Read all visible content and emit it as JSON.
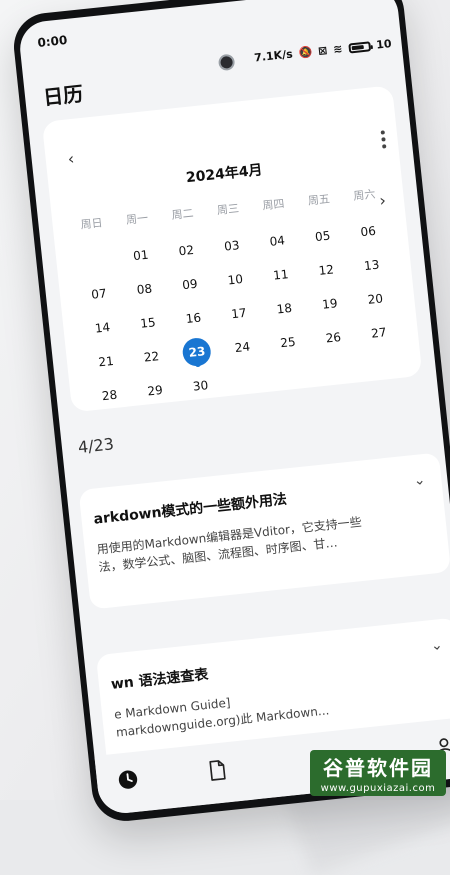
{
  "status_bar": {
    "time": "0:00",
    "network_speed": "7.1K/s",
    "battery_text": "10"
  },
  "app": {
    "title": "日历"
  },
  "calendar": {
    "month_title": "2024年4月",
    "weekdays": [
      "周日",
      "周一",
      "周二",
      "周三",
      "周四",
      "周五",
      "周六"
    ],
    "leading_empty": 1,
    "days": [
      "01",
      "02",
      "03",
      "04",
      "05",
      "06",
      "07",
      "08",
      "09",
      "10",
      "11",
      "12",
      "13",
      "14",
      "15",
      "16",
      "17",
      "18",
      "19",
      "20",
      "21",
      "22",
      "23",
      "24",
      "25",
      "26",
      "27",
      "28",
      "29",
      "30"
    ],
    "selected_day": "23",
    "accent_color": "#1976d2",
    "prev_icon": "chevron-left-icon",
    "next_icon": "chevron-right-icon"
  },
  "selected_date_label": "4/23",
  "notes": [
    {
      "title": "arkdown模式的一些额外用法",
      "lines": [
        "用使用的Markdown编辑器是Vditor，它支持一些",
        "法，数学公式、脑图、流程图、时序图、甘…"
      ]
    },
    {
      "title": "wn 语法速查表",
      "lines": [
        "e Markdown Guide]",
        "markdownguide.org)此 Markdown..."
      ]
    }
  ],
  "bottom_nav": [
    {
      "icon": "clock-icon",
      "active": true
    },
    {
      "icon": "document-icon",
      "active": false
    },
    {
      "icon": "person-icon",
      "active": false
    }
  ],
  "watermark": {
    "title": "谷普软件园",
    "url": "www.gupuxiazai.com"
  }
}
